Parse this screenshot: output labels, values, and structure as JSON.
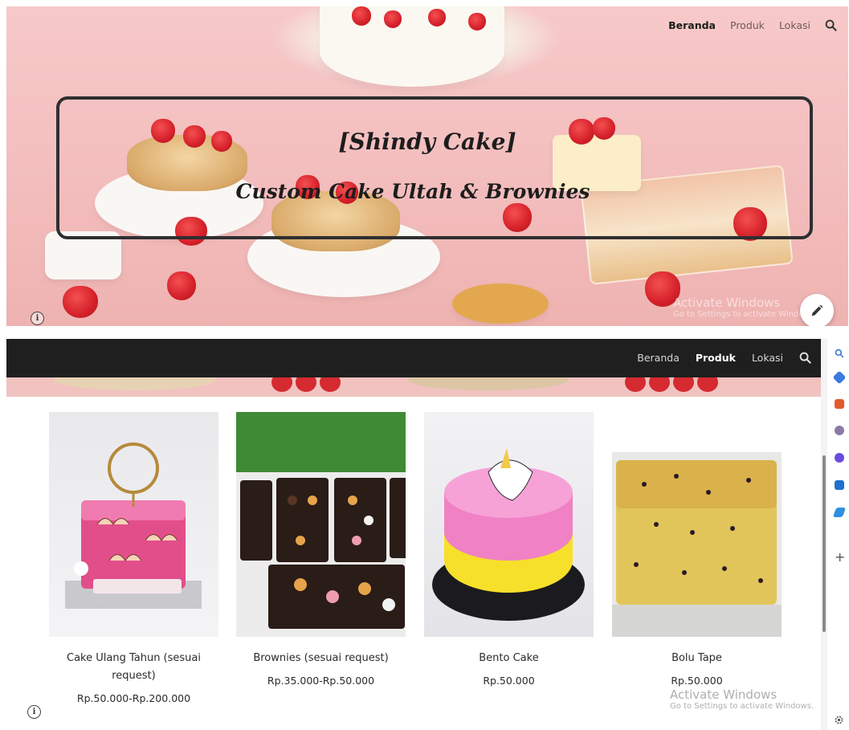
{
  "hero": {
    "title": "[Shindy Cake]",
    "subtitle": "Custom Cake Ultah & Brownies",
    "nav": [
      {
        "label": "Beranda",
        "active": true
      },
      {
        "label": "Produk",
        "active": false
      },
      {
        "label": "Lokasi",
        "active": false
      }
    ],
    "watermark_line1": "Activate Windows",
    "watermark_line2": "Go to Settings to activate Windows."
  },
  "navbar": {
    "items": [
      {
        "label": "Beranda",
        "active": false
      },
      {
        "label": "Produk",
        "active": true
      },
      {
        "label": "Lokasi",
        "active": false
      }
    ]
  },
  "products": [
    {
      "name": "Cake Ulang Tahun (sesuai request)",
      "price": "Rp.50.000-Rp.200.000",
      "image": "birthday-cake-photo"
    },
    {
      "name": "Brownies (sesuai request)",
      "price": "Rp.35.000-Rp.50.000",
      "image": "brownies-photo"
    },
    {
      "name": "Bento Cake",
      "price": "Rp.50.000",
      "image": "bento-cake-photo"
    },
    {
      "name": "Bolu Tape",
      "price": "Rp.50.000",
      "image": "bolu-tape-photo"
    }
  ],
  "watermark": {
    "line1": "Activate Windows",
    "line2": "Go to Settings to activate Windows."
  },
  "colors": {
    "hero_bg": "#f3bdbd",
    "navbar_bg": "#1f1f1f",
    "frame": "#2f2f31"
  },
  "icons": [
    "search-icon",
    "info-icon",
    "pencil-icon",
    "plus-icon",
    "gear-icon"
  ]
}
